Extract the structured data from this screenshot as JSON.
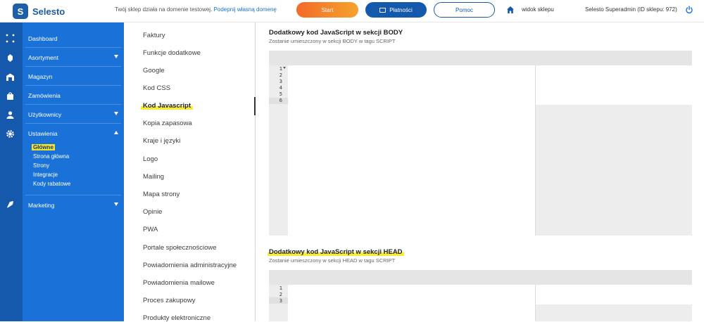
{
  "header": {
    "logo_text": "Selesto",
    "notice_text": "Twój sklep działa na domenie testowej.",
    "notice_link": "Podepnij własną domenę",
    "start_label": "Start",
    "payments_label": "Płatności",
    "help_label": "Pomoc",
    "store_view_label": "widok sklepu",
    "admin_label": "Selesto Superadmin (ID sklepu: 972)"
  },
  "sidebar": {
    "items": [
      {
        "label": "Dashboard"
      },
      {
        "label": "Asortyment"
      },
      {
        "label": "Magazyn"
      },
      {
        "label": "Zamówienia"
      },
      {
        "label": "Użytkownicy"
      },
      {
        "label": "Ustawienia"
      },
      {
        "label": "Marketing"
      }
    ],
    "subitems": [
      {
        "label": "Główne"
      },
      {
        "label": "Strona główna"
      },
      {
        "label": "Strony"
      },
      {
        "label": "Integracje"
      },
      {
        "label": "Kody rabatowe"
      }
    ]
  },
  "settings_menu": [
    "Faktury",
    "Funkcje dodatkowe",
    "Google",
    "Kod CSS",
    "Kod Javascript",
    "Kopia zapasowa",
    "Kraje i języki",
    "Logo",
    "Mailing",
    "Mapa strony",
    "Opinie",
    "PWA",
    "Portale społecznościowe",
    "Powiadomienia administracyjne",
    "Powiadomienia mailowe",
    "Proces zakupowy",
    "Produkty elektroniczne"
  ],
  "body_section": {
    "title": "Dodatkowy kod JavaScript w sekcji BODY",
    "subtitle": "Zostanie umieszczony w sekcji BODY w tagu SCRIPT",
    "line_numbers": [
      "1",
      "2",
      "3",
      "4",
      "5",
      "6"
    ]
  },
  "head_section": {
    "title": "Dodatkowy kod JavaScript w sekcji HEAD",
    "subtitle": "Zostanie umieszczony w sekcji HEAD w tagu SCRIPT",
    "line_numbers": [
      "1",
      "2",
      "3"
    ]
  },
  "colors": {
    "sidebar": "#1a72d8",
    "iconbar": "#1559ad",
    "highlight": "#f7ec32",
    "start_button": "#f26a2a"
  }
}
